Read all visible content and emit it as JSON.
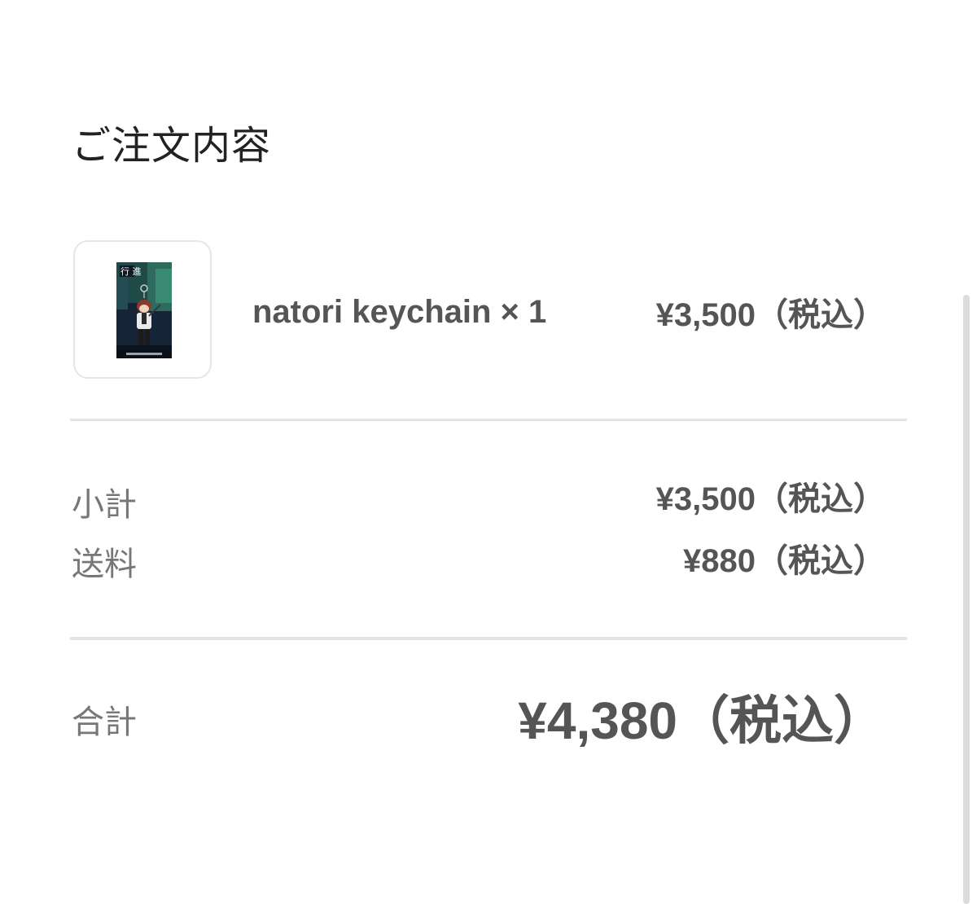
{
  "order": {
    "title": "ご注文内容",
    "item": {
      "name": "natori keychain × 1",
      "price": "¥3,500（税込）",
      "thumbnail_icon": "product-keychain-image",
      "thumbnail_text": "行 進"
    },
    "summary": {
      "subtotal_label": "小計",
      "subtotal_value": "¥3,500（税込）",
      "shipping_label": "送料",
      "shipping_value": "¥880（税込）"
    },
    "total": {
      "label": "合計",
      "value": "¥4,380（税込）"
    }
  },
  "colors": {
    "title_text": "#222222",
    "value_text": "#555555",
    "label_text": "#777777",
    "divider": "#e4e4e4",
    "thumb_border": "#e6e6e6"
  }
}
